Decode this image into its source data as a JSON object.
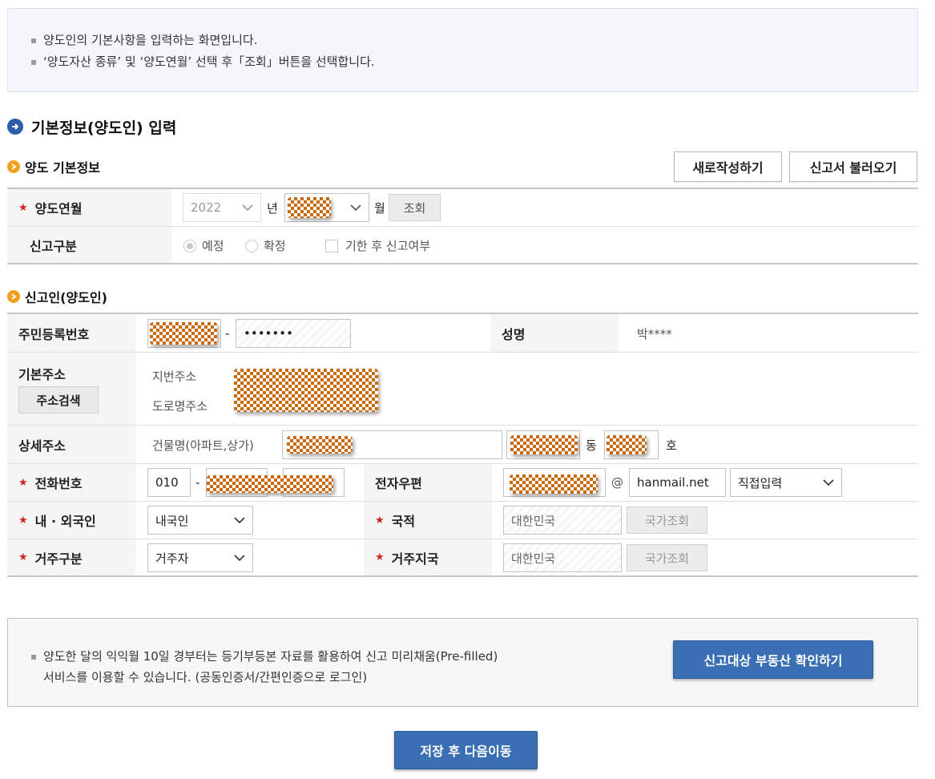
{
  "notice": {
    "line1": "양도인의 기본사항을 입력하는 화면입니다.",
    "line2": "‘양도자산 종류’ 및 ‘양도연월’ 선택 후「조회」버튼을 선택합니다."
  },
  "section": {
    "title": "기본정보(양도인) 입력"
  },
  "basic": {
    "subtitle": "양도 기본정보",
    "btn_new": "새로작성하기",
    "btn_load": "신고서 불러오기",
    "month_label": "양도연월",
    "year_value": "2022",
    "year_unit": "년",
    "month_unit": "월",
    "lookup_btn": "조회",
    "type_label": "신고구분",
    "radio_planned": "예정",
    "radio_final": "확정",
    "check_after": "기한 후 신고여부"
  },
  "reporter": {
    "subtitle": "신고인(양도인)",
    "rrn_label": "주민등록번호",
    "rrn_dash": "-",
    "rrn_masked": "•••••••",
    "name_label": "성명",
    "name_value": "박****",
    "addr_label": "기본주소",
    "addr_search_btn": "주소검색",
    "addr_lot": "지번주소",
    "addr_road": "도로명주소",
    "detail_label": "상세주소",
    "building_label": "건물명(아파트,상가)",
    "dong_unit": "동",
    "ho_unit": "호",
    "phone_label": "전화번호",
    "phone_prefix": "010",
    "phone_dash": "-",
    "email_label": "전자우편",
    "email_at": "@",
    "email_domain": "hanmail.net",
    "email_select": "직접입력",
    "foreign_label": "내 · 외국인",
    "foreign_value": "내국인",
    "nationality_label": "국적",
    "nationality_value": "대한민국",
    "country_lookup_btn": "국가조회",
    "residency_label": "거주구분",
    "residency_value": "거주자",
    "residence_country_label": "거주지국",
    "residence_country_value": "대한민국",
    "country_lookup_btn2": "국가조회"
  },
  "prefill": {
    "line1": "양도한 달의 익익월 10일 경부터는 등기부등본 자료를 활용하여 신고 미리채움(Pre-filled)",
    "line2": "서비스를 이용할 수 있습니다. (공동인증서/간편인증으로 로그인)",
    "btn": "신고대상 부동산 확인하기"
  },
  "footer": {
    "save_btn": "저장 후 다음이동"
  }
}
